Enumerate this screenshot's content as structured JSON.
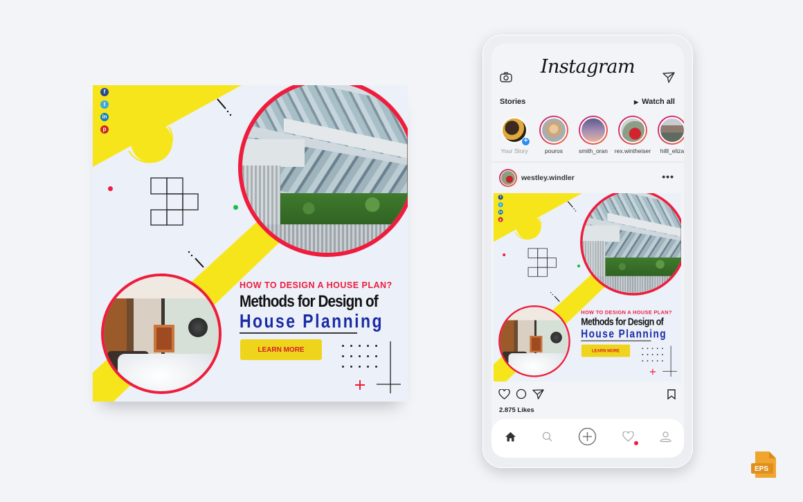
{
  "post": {
    "social_icons": [
      {
        "name": "facebook-icon",
        "glyph": "f"
      },
      {
        "name": "twitter-icon",
        "glyph": "t"
      },
      {
        "name": "linkedin-icon",
        "glyph": "in"
      },
      {
        "name": "pinterest-icon",
        "glyph": "p"
      }
    ],
    "kicker": "HOW TO DESIGN A HOUSE PLAN?",
    "title_line1": "Methods for Design of",
    "title_line2": "House Planning",
    "cta_label": "LEARN MORE",
    "colors": {
      "yellow": "#f7e51c",
      "red": "#ef1c3c",
      "blue": "#1a2ba6",
      "background": "#ecf0f8",
      "green": "#17c04a"
    }
  },
  "phone": {
    "app_name": "Instagram",
    "stories_label": "Stories",
    "watch_all_label": "Watch all",
    "stories": [
      {
        "name": "Your Story",
        "own": true
      },
      {
        "name": "pouros"
      },
      {
        "name": "smith_oran"
      },
      {
        "name": "rex.wintheiser"
      },
      {
        "name": "hilll_eliza"
      }
    ],
    "post_user": "westley.windler",
    "more_label": "•••",
    "likes": "2.875 Likes",
    "tabbar": [
      "home-icon",
      "search-icon",
      "add-post-icon",
      "activity-heart-icon",
      "profile-icon"
    ]
  },
  "badge": {
    "label": "EPS",
    "color": "#f0a52e"
  }
}
